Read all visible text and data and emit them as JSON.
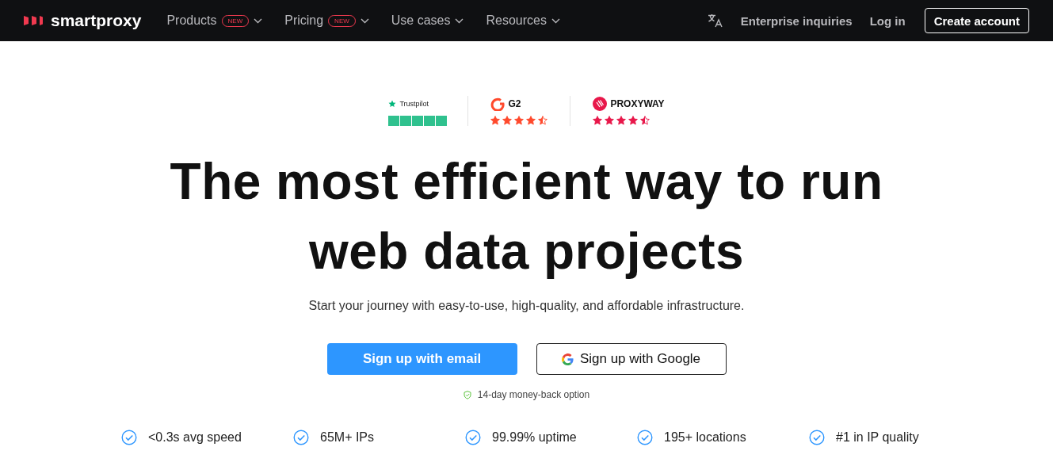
{
  "nav": {
    "logo": "smartproxy",
    "menu": [
      {
        "label": "Products",
        "badge": "NEW"
      },
      {
        "label": "Pricing",
        "badge": "NEW"
      },
      {
        "label": "Use cases"
      },
      {
        "label": "Resources"
      }
    ],
    "links": [
      "Enterprise inquiries",
      "Log in"
    ],
    "cta": "Create account"
  },
  "ratings": [
    {
      "kind": "trustpilot",
      "name": "Trustpilot",
      "stars": 5
    },
    {
      "kind": "g2",
      "name": "G2",
      "stars": 4.5
    },
    {
      "kind": "proxyway",
      "name": "PROXYWAY",
      "stars": 4.5
    }
  ],
  "headline": "The most efficient way to run web data projects",
  "subtitle": "Start your journey with easy-to-use, high-quality, and affordable infrastructure.",
  "buttons": [
    {
      "kind": "primary",
      "label": "Sign up with email"
    },
    {
      "kind": "google",
      "label": "Sign up with Google"
    }
  ],
  "guarantee": "14-day money-back option",
  "features": [
    "<0.3s avg speed",
    "65M+ IPs",
    "99.99% uptime",
    "195+ locations",
    "#1 in IP quality"
  ]
}
